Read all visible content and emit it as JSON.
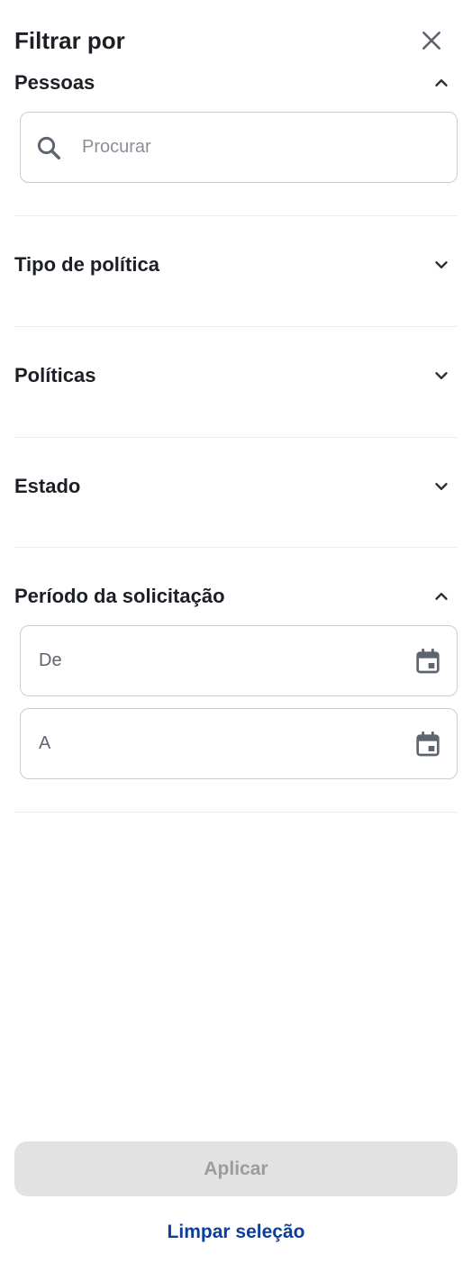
{
  "header": {
    "title": "Filtrar por",
    "close_icon": "close-icon"
  },
  "people": {
    "title": "Pessoas",
    "expanded": true,
    "search": {
      "placeholder": "Procurar",
      "value": "",
      "icon": "search-icon"
    }
  },
  "policy_type": {
    "title": "Tipo de política",
    "expanded": false
  },
  "policies": {
    "title": "Políticas",
    "expanded": false
  },
  "status": {
    "title": "Estado",
    "expanded": false
  },
  "request_period": {
    "title": "Período da solicitação",
    "expanded": true,
    "from": {
      "placeholder": "De",
      "value": "",
      "icon": "calendar-icon"
    },
    "to": {
      "placeholder": "A",
      "value": "",
      "icon": "calendar-icon"
    }
  },
  "footer": {
    "apply_label": "Aplicar",
    "apply_enabled": false,
    "clear_label": "Limpar seleção"
  },
  "colors": {
    "primary_link": "#0b3f9c",
    "disabled_button_bg": "#e2e2e2",
    "disabled_button_text": "#9c9c9c",
    "border": "#c9ccd1"
  }
}
